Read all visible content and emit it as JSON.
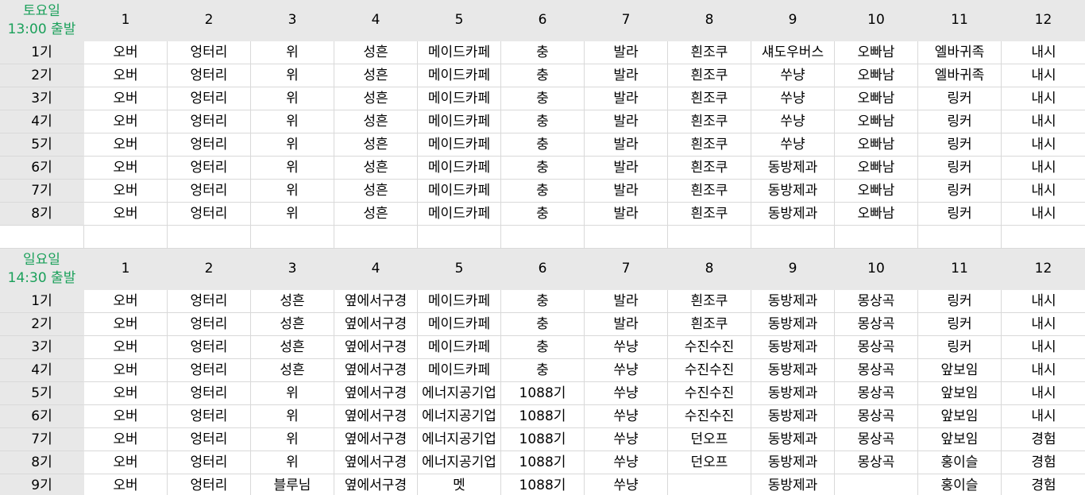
{
  "colors": {
    "header_bg": "#e8e8e8",
    "label_green": "#1aa05a",
    "grid": "#d9d9d9"
  },
  "columns": [
    "1",
    "2",
    "3",
    "4",
    "5",
    "6",
    "7",
    "8",
    "9",
    "10",
    "11",
    "12"
  ],
  "saturday": {
    "day": "토요일",
    "time": "13:00 출발",
    "rows": [
      {
        "label": "1기",
        "cells": [
          "오버",
          "엉터리",
          "위",
          "성흔",
          "메이드카페",
          "충",
          "발라",
          "흰조쿠",
          "섀도우버스",
          "오빠남",
          "엘바귀족",
          "내시"
        ]
      },
      {
        "label": "2기",
        "cells": [
          "오버",
          "엉터리",
          "위",
          "성흔",
          "메이드카페",
          "충",
          "발라",
          "흰조쿠",
          "쑤냥",
          "오빠남",
          "엘바귀족",
          "내시"
        ]
      },
      {
        "label": "3기",
        "cells": [
          "오버",
          "엉터리",
          "위",
          "성흔",
          "메이드카페",
          "충",
          "발라",
          "흰조쿠",
          "쑤냥",
          "오빠남",
          "링커",
          "내시"
        ]
      },
      {
        "label": "4기",
        "cells": [
          "오버",
          "엉터리",
          "위",
          "성흔",
          "메이드카페",
          "충",
          "발라",
          "흰조쿠",
          "쑤냥",
          "오빠남",
          "링커",
          "내시"
        ]
      },
      {
        "label": "5기",
        "cells": [
          "오버",
          "엉터리",
          "위",
          "성흔",
          "메이드카페",
          "충",
          "발라",
          "흰조쿠",
          "쑤냥",
          "오빠남",
          "링커",
          "내시"
        ]
      },
      {
        "label": "6기",
        "cells": [
          "오버",
          "엉터리",
          "위",
          "성흔",
          "메이드카페",
          "충",
          "발라",
          "흰조쿠",
          "동방제과",
          "오빠남",
          "링커",
          "내시"
        ]
      },
      {
        "label": "7기",
        "cells": [
          "오버",
          "엉터리",
          "위",
          "성흔",
          "메이드카페",
          "충",
          "발라",
          "흰조쿠",
          "동방제과",
          "오빠남",
          "링커",
          "내시"
        ]
      },
      {
        "label": "8기",
        "cells": [
          "오버",
          "엉터리",
          "위",
          "성흔",
          "메이드카페",
          "충",
          "발라",
          "흰조쿠",
          "동방제과",
          "오빠남",
          "링커",
          "내시"
        ]
      }
    ]
  },
  "sunday": {
    "day": "일요일",
    "time": "14:30 출발",
    "rows": [
      {
        "label": "1기",
        "cells": [
          "오버",
          "엉터리",
          "성흔",
          "옆에서구경",
          "메이드카페",
          "충",
          "발라",
          "흰조쿠",
          "동방제과",
          "몽상곡",
          "링커",
          "내시"
        ]
      },
      {
        "label": "2기",
        "cells": [
          "오버",
          "엉터리",
          "성흔",
          "옆에서구경",
          "메이드카페",
          "충",
          "발라",
          "흰조쿠",
          "동방제과",
          "몽상곡",
          "링커",
          "내시"
        ]
      },
      {
        "label": "3기",
        "cells": [
          "오버",
          "엉터리",
          "성흔",
          "옆에서구경",
          "메이드카페",
          "충",
          "쑤냥",
          "수진수진",
          "동방제과",
          "몽상곡",
          "링커",
          "내시"
        ]
      },
      {
        "label": "4기",
        "cells": [
          "오버",
          "엉터리",
          "성흔",
          "옆에서구경",
          "메이드카페",
          "충",
          "쑤냥",
          "수진수진",
          "동방제과",
          "몽상곡",
          "앞보임",
          "내시"
        ]
      },
      {
        "label": "5기",
        "cells": [
          "오버",
          "엉터리",
          "위",
          "옆에서구경",
          "에너지공기업",
          "1088기",
          "쑤냥",
          "수진수진",
          "동방제과",
          "몽상곡",
          "앞보임",
          "내시"
        ]
      },
      {
        "label": "6기",
        "cells": [
          "오버",
          "엉터리",
          "위",
          "옆에서구경",
          "에너지공기업",
          "1088기",
          "쑤냥",
          "수진수진",
          "동방제과",
          "몽상곡",
          "앞보임",
          "내시"
        ]
      },
      {
        "label": "7기",
        "cells": [
          "오버",
          "엉터리",
          "위",
          "옆에서구경",
          "에너지공기업",
          "1088기",
          "쑤냥",
          "던오프",
          "동방제과",
          "몽상곡",
          "앞보임",
          "경험"
        ]
      },
      {
        "label": "8기",
        "cells": [
          "오버",
          "엉터리",
          "위",
          "옆에서구경",
          "에너지공기업",
          "1088기",
          "쑤냥",
          "던오프",
          "동방제과",
          "몽상곡",
          "홍이슬",
          "경험"
        ]
      },
      {
        "label": "9기",
        "cells": [
          "오버",
          "엉터리",
          "블루님",
          "옆에서구경",
          "멧",
          "1088기",
          "쑤냥",
          "",
          "동방제과",
          "",
          "홍이슬",
          "경험"
        ]
      }
    ]
  }
}
